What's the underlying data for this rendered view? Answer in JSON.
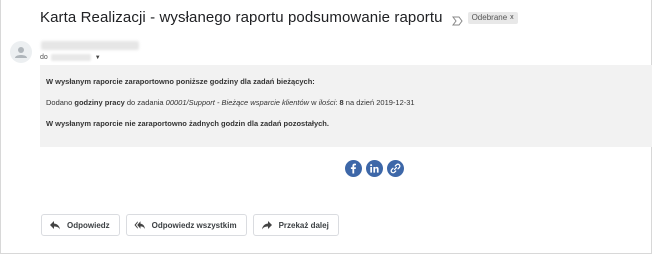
{
  "email": {
    "subject": "Karta Realizacji - wysłanego raportu podsumowanie raportu",
    "badge_label": "Odebrane",
    "badge_close": "x",
    "to_label": "do",
    "body": {
      "line1": "W wysłanym raporcie zaraportowno poniższe godziny dla zadań bieżących:",
      "line2_prefix": "Dodano ",
      "line2_bold": "godziny pracy",
      "line2_mid": " do zadania ",
      "line2_task": "00001/Support - Bieżące wsparcie klientów",
      "line2_w": " w ",
      "line2_qty_label": "ilości",
      "line2_colon": ": ",
      "line2_qty": "8",
      "line2_suffix": " na dzień 2019-12-31",
      "line3": "W wysłanym raporcie nie zaraportowno żadnych godzin dla zadań pozostałych."
    }
  },
  "share": {
    "items": [
      {
        "name": "facebook",
        "icon": "facebook-icon"
      },
      {
        "name": "linkedin",
        "icon": "linkedin-icon"
      },
      {
        "name": "link",
        "icon": "link-icon"
      }
    ],
    "color": "#3d67a8"
  },
  "actions": {
    "reply": "Odpowiedz",
    "reply_all": "Odpowiedz wszystkim",
    "forward": "Przekaż dalej"
  }
}
